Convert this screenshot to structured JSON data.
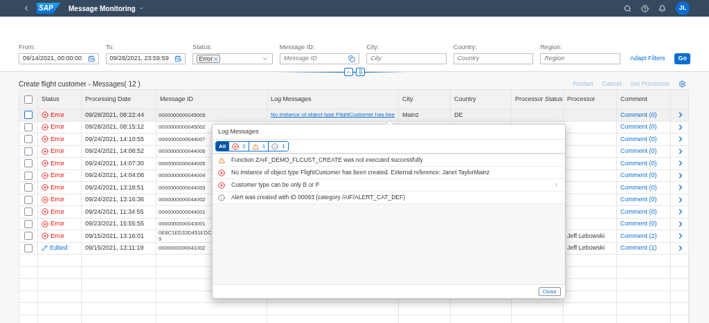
{
  "shell": {
    "title": "Message Monitoring",
    "logo": "SAP",
    "avatar": "JL"
  },
  "filters": [
    {
      "label": "From:",
      "kind": "date",
      "value": "09/14/2021, 00:00:00"
    },
    {
      "label": "To:",
      "kind": "date",
      "value": "09/28/2021, 23:59:59"
    },
    {
      "label": "Status:",
      "kind": "multi",
      "tokens": [
        "Error"
      ]
    },
    {
      "label": "Message ID:",
      "kind": "valuehelp",
      "placeholder": "Message ID"
    },
    {
      "label": "City:",
      "kind": "text",
      "placeholder": "City"
    },
    {
      "label": "Country:",
      "kind": "text",
      "placeholder": "Country"
    },
    {
      "label": "Region:",
      "kind": "text",
      "placeholder": "Region"
    }
  ],
  "adapt_filters": "Adapt Filters",
  "go": "Go",
  "table": {
    "title": "Create flight customer - Messages( 12 )",
    "select_all_checked": false,
    "actions": [
      {
        "label": "Restart",
        "disabled": true
      },
      {
        "label": "Cancel",
        "disabled": true
      },
      {
        "label": "Set Processor",
        "disabled": true
      }
    ],
    "columns": [
      "Status",
      "Processing Date",
      "Message ID",
      "Log Messages",
      "City",
      "Country",
      "Processor Status",
      "Processor",
      "Comment"
    ],
    "rows": [
      {
        "status": "Error",
        "kind": "error",
        "date": "09/28/2021, 08:22:44",
        "message_id": [
          "0000000000045005"
        ],
        "log": "No instance of object type FlightCustomer has bee",
        "city": "Mainz",
        "country": "DE",
        "comment": "Comment (0)",
        "hovered": true,
        "checked": false
      },
      {
        "status": "Error",
        "kind": "error",
        "date": "09/28/2021, 08:15:12",
        "message_id": [
          "0000000000045002"
        ],
        "comment": "Comment (0)",
        "hovered": false,
        "checked": false
      },
      {
        "status": "Error",
        "kind": "error",
        "date": "09/24/2021, 14:10:55",
        "message_id": [
          "0000000000044007"
        ],
        "comment": "Comment (0)",
        "hovered": false,
        "checked": false
      },
      {
        "status": "Error",
        "kind": "error",
        "date": "09/24/2021, 14:08:52",
        "message_id": [
          "0000000000044006"
        ],
        "comment": "Comment (0)",
        "hovered": false,
        "checked": false
      },
      {
        "status": "Error",
        "kind": "error",
        "date": "09/24/2021, 14:07:30",
        "message_id": [
          "0000000000044005"
        ],
        "comment": "Comment (0)",
        "hovered": false,
        "checked": false
      },
      {
        "status": "Error",
        "kind": "error",
        "date": "09/24/2021, 14:04:08",
        "message_id": [
          "0000000000044004"
        ],
        "comment": "Comment (0)",
        "hovered": false,
        "checked": false
      },
      {
        "status": "Error",
        "kind": "error",
        "date": "09/24/2021, 13:18:51",
        "message_id": [
          "0000000000044003"
        ],
        "comment": "Comment (0)",
        "hovered": false,
        "checked": false
      },
      {
        "status": "Error",
        "kind": "error",
        "date": "09/24/2021, 13:16:36",
        "message_id": [
          "0000000000044002"
        ],
        "comment": "Comment (0)",
        "hovered": false,
        "checked": false
      },
      {
        "status": "Error",
        "kind": "error",
        "date": "09/24/2021, 11:34:55",
        "message_id": [
          "0000000000044001"
        ],
        "comment": "Comment (0)",
        "hovered": false,
        "checked": false
      },
      {
        "status": "Error",
        "kind": "error",
        "date": "09/23/2021, 15:55:55",
        "message_id": [
          "0000000000043001"
        ],
        "comment": "Comment (0)",
        "hovered": false,
        "checked": false
      },
      {
        "status": "Error",
        "kind": "error",
        "date": "09/15/2021, 13:16:01",
        "message_id": [
          "0E8C1ED33D451EDC",
          "9"
        ],
        "processor": "Jeff Lebowski",
        "comment": "Comment (2)",
        "hovered": false,
        "checked": false
      },
      {
        "status": "Edited",
        "kind": "edited",
        "date": "09/15/2021, 13:11:19",
        "message_id": [
          "0000000000041002"
        ],
        "processor": "Jeff Lebowski",
        "comment": "Comment (1)",
        "hovered": false,
        "checked": false
      }
    ]
  },
  "popover": {
    "title": "Log Messages",
    "segments": [
      {
        "kind": "all",
        "label": "All",
        "selected": true
      },
      {
        "kind": "error",
        "label": "2",
        "selected": false
      },
      {
        "kind": "warning",
        "label": "1",
        "selected": false
      },
      {
        "kind": "info",
        "label": "1",
        "selected": false
      }
    ],
    "messages": [
      {
        "kind": "warning",
        "text": "Function ZAIF_DEMO_FLCUST_CREATE was not executed successfully",
        "has_details": false
      },
      {
        "kind": "error",
        "text": "No instance of object type FlightCustomer has been created. External reference: Janet TaylorMainz",
        "has_details": false
      },
      {
        "kind": "error",
        "text": "Customer type can be only B or P",
        "has_details": true
      },
      {
        "kind": "info",
        "text": "Alert was created with ID 00093 (category /AIF/ALERT_CAT_DEF)",
        "has_details": false
      }
    ],
    "close": "Close"
  }
}
